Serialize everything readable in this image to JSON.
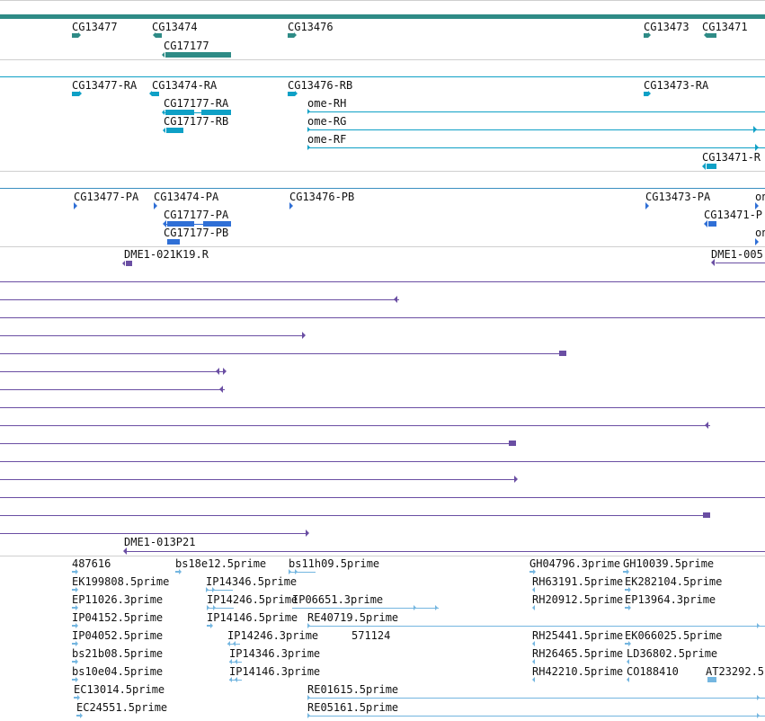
{
  "colors": {
    "gene": "#2e8b86",
    "transcript": "#0ea0c6",
    "cds": "#2f6fd6",
    "clone": "#6a4ea3",
    "est": "#74b6e0",
    "separator": "#cfcfcf"
  },
  "tracks": [
    {
      "name": "genes",
      "color": "gene",
      "features": [
        {
          "label": "CG13477",
          "glyph": "arrow-right"
        },
        {
          "label": "CG13474",
          "glyph": "arrow-left"
        },
        {
          "label": "CG17177",
          "glyph": "bar"
        },
        {
          "label": "CG13476",
          "glyph": "arrow-right"
        },
        {
          "label": "CG13473",
          "glyph": "arrow-right"
        },
        {
          "label": "CG13471",
          "glyph": "arrow-left"
        }
      ]
    },
    {
      "name": "transcripts",
      "color": "transcript",
      "features": [
        {
          "label": "CG13477-RA"
        },
        {
          "label": "CG13474-RA"
        },
        {
          "label": "CG17177-RA"
        },
        {
          "label": "CG17177-RB"
        },
        {
          "label": "CG13476-RB"
        },
        {
          "label": "ome-RH"
        },
        {
          "label": "ome-RG"
        },
        {
          "label": "ome-RF"
        },
        {
          "label": "CG13473-RA"
        },
        {
          "label": "CG13471-R"
        }
      ]
    },
    {
      "name": "proteins",
      "color": "cds",
      "features": [
        {
          "label": "CG13477-PA"
        },
        {
          "label": "CG13474-PA"
        },
        {
          "label": "CG17177-PA"
        },
        {
          "label": "CG17177-PB"
        },
        {
          "label": "CG13476-PB"
        },
        {
          "label": "CG13473-PA"
        },
        {
          "label": "CG13471-P"
        },
        {
          "label": "on"
        },
        {
          "label": "on"
        }
      ]
    },
    {
      "name": "clones",
      "color": "clone",
      "features": [
        {
          "label": "DME1-021K19.R"
        },
        {
          "label": "DME1-005"
        },
        {
          "label": "DME1-013P21"
        }
      ]
    },
    {
      "name": "ests",
      "color": "est",
      "features": [
        {
          "label": "487616"
        },
        {
          "label": "bs18e12.5prime"
        },
        {
          "label": "bs11h09.5prime"
        },
        {
          "label": "GH04796.3prime"
        },
        {
          "label": "GH10039.5prime"
        },
        {
          "label": "EK199808.5prime"
        },
        {
          "label": "IP14346.5prime"
        },
        {
          "label": "RH63191.5prime"
        },
        {
          "label": "EK282104.5prime"
        },
        {
          "label": "EP11026.3prime"
        },
        {
          "label": "IP14246.5prime"
        },
        {
          "label": "IP06651.3prime"
        },
        {
          "label": "RH20912.5prime"
        },
        {
          "label": "EP13964.3prime"
        },
        {
          "label": "IP04152.5prime"
        },
        {
          "label": "IP14146.5prime"
        },
        {
          "label": "RE40719.5prime"
        },
        {
          "label": "IP04052.5prime"
        },
        {
          "label": "IP14246.3prime"
        },
        {
          "label": "571124"
        },
        {
          "label": "RH25441.5prime"
        },
        {
          "label": "EK066025.5prime"
        },
        {
          "label": "bs21b08.5prime"
        },
        {
          "label": "IP14346.3prime"
        },
        {
          "label": "RH26465.5prime"
        },
        {
          "label": "LD36802.5prime"
        },
        {
          "label": "bs10e04.5prime"
        },
        {
          "label": "IP14146.3prime"
        },
        {
          "label": "RH42210.5prime"
        },
        {
          "label": "CO188410"
        },
        {
          "label": "AT23292.5"
        },
        {
          "label": "EC13014.5prime"
        },
        {
          "label": "RE01615.5prime"
        },
        {
          "label": "EC24551.5prime"
        },
        {
          "label": "RE05161.5prime"
        }
      ]
    }
  ]
}
